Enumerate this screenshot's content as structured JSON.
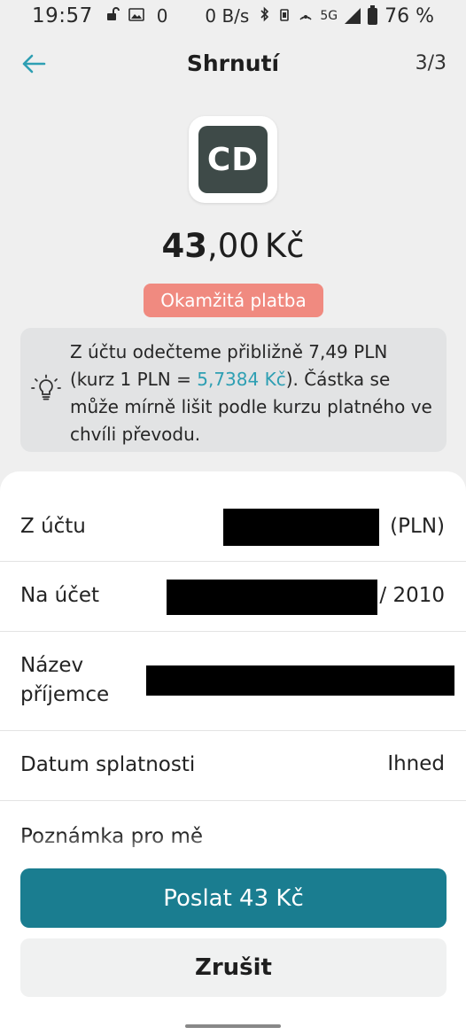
{
  "status_bar": {
    "time": "19:57",
    "mini_zero": "0",
    "network_speed": "0 B/s",
    "network_type": "5G",
    "battery": "76 %"
  },
  "nav": {
    "title": "Shrnutí",
    "step": "3/3"
  },
  "logo": {
    "text": "CD"
  },
  "amount": {
    "whole": "43",
    "decimal": ",00",
    "currency": "Kč"
  },
  "badge": {
    "label": "Okamžitá platba"
  },
  "info": {
    "text_before": "Z účtu odečteme přibližně 7,49 PLN (kurz 1 PLN = ",
    "rate": "5,7384 Kč",
    "text_after": "). Částka se může mírně lišit podle kurzu platného ve chvíli převodu."
  },
  "details": {
    "from_label": "Z účtu",
    "from_value": "(PLN)",
    "to_label": "Na účet",
    "to_value": "/ 2010",
    "recipient_label_1": "Název",
    "recipient_label_2": "příjemce",
    "due_label": "Datum splatnosti",
    "due_value": "Ihned",
    "note_label": "Poznámka pro mě"
  },
  "actions": {
    "send_label": "Poslat 43 Kč",
    "cancel_label": "Zrušit"
  },
  "colors": {
    "primary": "#1a7d90",
    "accent": "#2e9fb3",
    "badge": "#f08a80",
    "logo_bg": "#3e4a48"
  }
}
